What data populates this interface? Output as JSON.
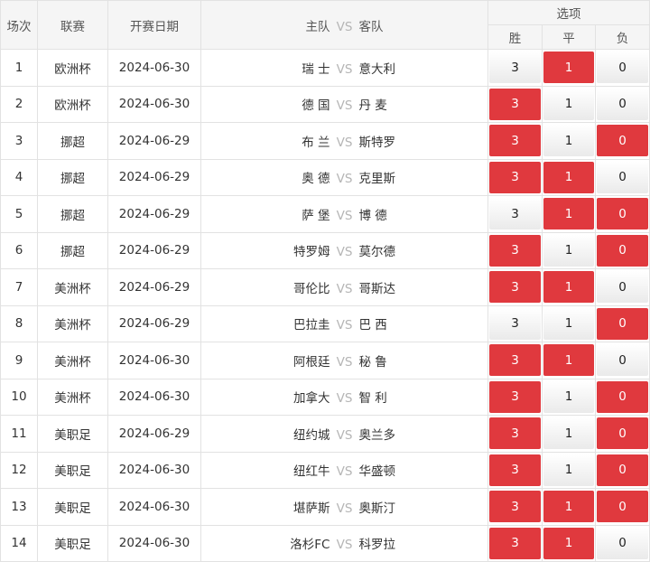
{
  "header": {
    "no": "场次",
    "league": "联赛",
    "date": "开赛日期",
    "home": "主队",
    "vs": "VS",
    "away": "客队",
    "options": "选项",
    "win": "胜",
    "draw": "平",
    "lose": "负"
  },
  "colors": {
    "selected": "#e0393e",
    "vs": "#b5b5b5"
  },
  "matches": [
    {
      "no": "1",
      "league": "欧洲杯",
      "date": "2024-06-30",
      "home": "瑞 士",
      "away": "意大利",
      "win": "3",
      "draw": "1",
      "lose": "0",
      "sel": [
        false,
        true,
        false
      ]
    },
    {
      "no": "2",
      "league": "欧洲杯",
      "date": "2024-06-30",
      "home": "德 国",
      "away": "丹 麦",
      "win": "3",
      "draw": "1",
      "lose": "0",
      "sel": [
        true,
        false,
        false
      ]
    },
    {
      "no": "3",
      "league": "挪超",
      "date": "2024-06-29",
      "home": "布 兰",
      "away": "斯特罗",
      "win": "3",
      "draw": "1",
      "lose": "0",
      "sel": [
        true,
        false,
        true
      ]
    },
    {
      "no": "4",
      "league": "挪超",
      "date": "2024-06-29",
      "home": "奥 德",
      "away": "克里斯",
      "win": "3",
      "draw": "1",
      "lose": "0",
      "sel": [
        true,
        true,
        false
      ]
    },
    {
      "no": "5",
      "league": "挪超",
      "date": "2024-06-29",
      "home": "萨 堡",
      "away": "博 德",
      "win": "3",
      "draw": "1",
      "lose": "0",
      "sel": [
        false,
        true,
        true
      ]
    },
    {
      "no": "6",
      "league": "挪超",
      "date": "2024-06-29",
      "home": "特罗姆",
      "away": "莫尔德",
      "win": "3",
      "draw": "1",
      "lose": "0",
      "sel": [
        true,
        false,
        true
      ]
    },
    {
      "no": "7",
      "league": "美洲杯",
      "date": "2024-06-29",
      "home": "哥伦比",
      "away": "哥斯达",
      "win": "3",
      "draw": "1",
      "lose": "0",
      "sel": [
        true,
        true,
        false
      ]
    },
    {
      "no": "8",
      "league": "美洲杯",
      "date": "2024-06-29",
      "home": "巴拉圭",
      "away": "巴 西",
      "win": "3",
      "draw": "1",
      "lose": "0",
      "sel": [
        false,
        false,
        true
      ]
    },
    {
      "no": "9",
      "league": "美洲杯",
      "date": "2024-06-30",
      "home": "阿根廷",
      "away": "秘 鲁",
      "win": "3",
      "draw": "1",
      "lose": "0",
      "sel": [
        true,
        true,
        false
      ]
    },
    {
      "no": "10",
      "league": "美洲杯",
      "date": "2024-06-30",
      "home": "加拿大",
      "away": "智 利",
      "win": "3",
      "draw": "1",
      "lose": "0",
      "sel": [
        true,
        false,
        true
      ]
    },
    {
      "no": "11",
      "league": "美职足",
      "date": "2024-06-29",
      "home": "纽约城",
      "away": "奥兰多",
      "win": "3",
      "draw": "1",
      "lose": "0",
      "sel": [
        true,
        false,
        true
      ]
    },
    {
      "no": "12",
      "league": "美职足",
      "date": "2024-06-30",
      "home": "纽红牛",
      "away": "华盛顿",
      "win": "3",
      "draw": "1",
      "lose": "0",
      "sel": [
        true,
        false,
        true
      ]
    },
    {
      "no": "13",
      "league": "美职足",
      "date": "2024-06-30",
      "home": "堪萨斯",
      "away": "奥斯汀",
      "win": "3",
      "draw": "1",
      "lose": "0",
      "sel": [
        true,
        true,
        true
      ]
    },
    {
      "no": "14",
      "league": "美职足",
      "date": "2024-06-30",
      "home": "洛杉FC",
      "away": "科罗拉",
      "win": "3",
      "draw": "1",
      "lose": "0",
      "sel": [
        true,
        true,
        false
      ]
    }
  ]
}
